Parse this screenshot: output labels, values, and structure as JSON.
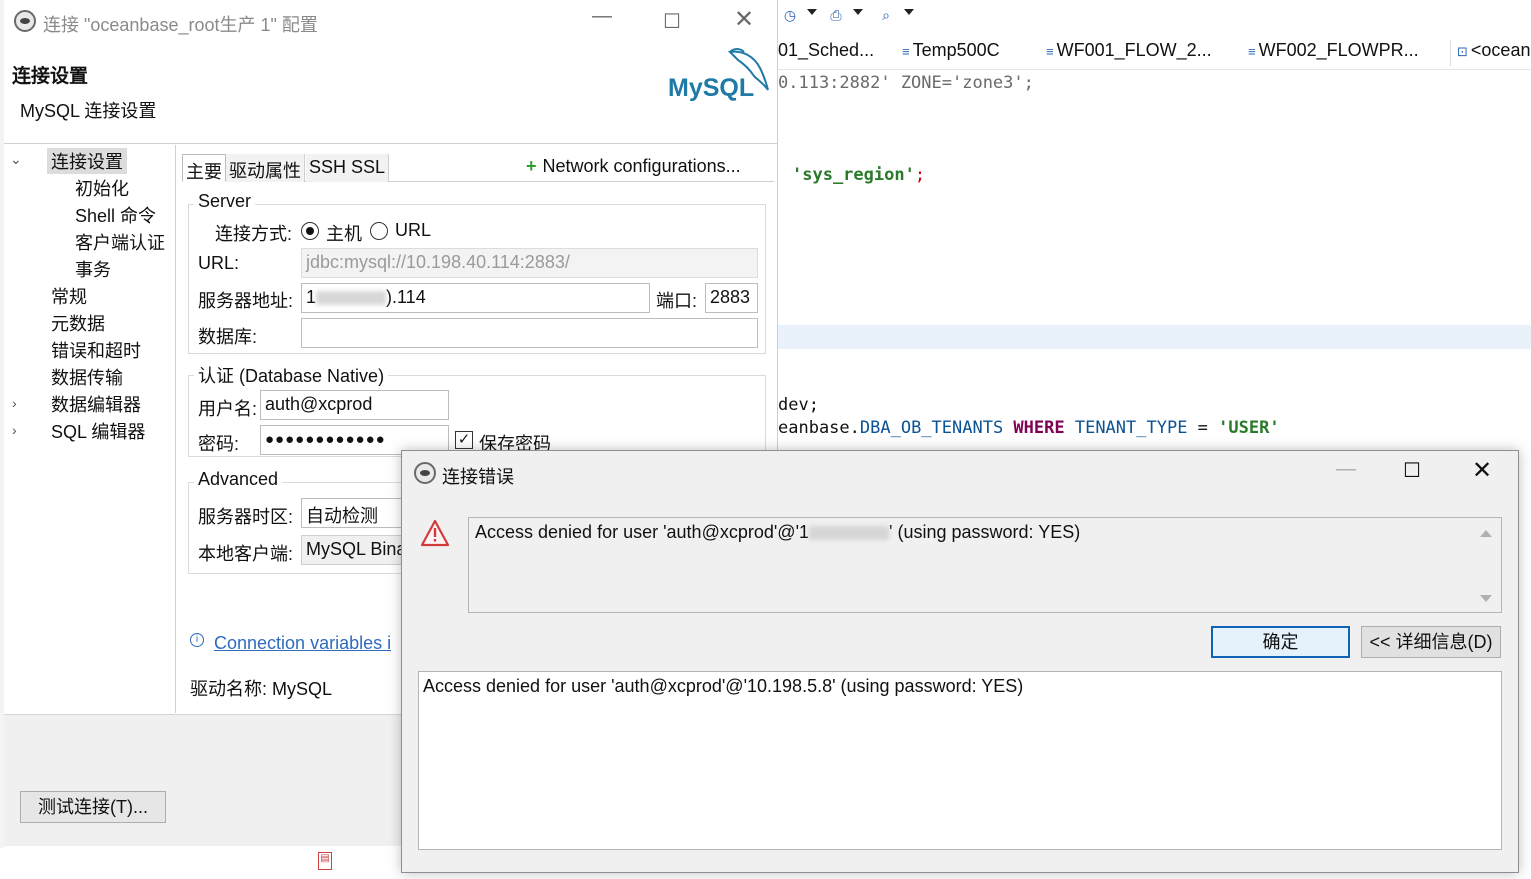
{
  "background": {
    "editor_tabs": [
      {
        "label": "01_Sched..."
      },
      {
        "label": "Temp500C"
      },
      {
        "label": "WF001_FLOW_2..."
      },
      {
        "label": "WF002_FLOWPR..."
      },
      {
        "label": "<ocean"
      }
    ],
    "code": {
      "line1": "0.113:2882' ZONE='zone3';",
      "line2_str": "'sys_region'",
      "line2_end": ";",
      "line3": "dev;",
      "line4_a": "eanbase.",
      "line4_b": "DBA_OB_TENANTS",
      "line4_c": " WHERE ",
      "line4_d": "TENANT_TYPE",
      "line4_e": " = ",
      "line4_f": "'USER'"
    }
  },
  "config_window": {
    "title": "连接 \"oceanbase_root生产 1\" 配置",
    "heading": "连接设置",
    "subheading": "MySQL 连接设置",
    "logo_text": "MySQL",
    "nav": [
      {
        "label": "连接设置"
      },
      {
        "label": "初始化"
      },
      {
        "label": "Shell 命令"
      },
      {
        "label": "客户端认证"
      },
      {
        "label": "事务"
      },
      {
        "label": "常规"
      },
      {
        "label": "元数据"
      },
      {
        "label": "错误和超时"
      },
      {
        "label": "数据传输"
      },
      {
        "label": "数据编辑器"
      },
      {
        "label": "SQL 编辑器"
      }
    ],
    "tabs": [
      {
        "label": "主要"
      },
      {
        "label": "驱动属性"
      },
      {
        "label": "SSH"
      },
      {
        "label": "SSL"
      }
    ],
    "network_config": "Network configurations...",
    "server": {
      "group_title": "Server",
      "connect_mode_label": "连接方式:",
      "option_host": "主机",
      "option_url": "URL",
      "url_label": "URL:",
      "url_value": "jdbc:mysql://10.198.40.114:2883/",
      "host_label": "服务器地址:",
      "host_value_prefix": "1",
      "host_value_suffix": ").114",
      "port_label": "端口:",
      "port_value": "2883",
      "db_label": "数据库:",
      "db_value": ""
    },
    "auth": {
      "group_title": "认证 (Database Native)",
      "user_label": "用户名:",
      "user_value": "auth@xcprod",
      "pwd_label": "密码:",
      "pwd_value": "●●●●●●●●●●●●",
      "save_pwd_label": "保存密码"
    },
    "advanced": {
      "group_title": "Advanced",
      "tz_label": "服务器时区:",
      "tz_value": "自动检测",
      "client_label": "本地客户端:",
      "client_value": "MySQL Bina"
    },
    "conn_vars_link": "Connection variables i",
    "driver_label": "驱动名称:",
    "driver_value": "MySQL",
    "test_button": "测试连接(T)..."
  },
  "error_dialog": {
    "title": "连接错误",
    "message_prefix": "Access denied for user 'auth@xcprod'@'1",
    "message_suffix": "' (using password: YES)",
    "ok_button": "确定",
    "details_button": "<< 详细信息(D)",
    "details_text": "Access denied for user 'auth@xcprod'@'10.198.5.8' (using password: YES)"
  },
  "colors": {
    "keyword": "#7f0055",
    "string": "#2a7a2a",
    "identifier": "#0b5394",
    "accent": "#0f62b6",
    "warning": "#d23c3c"
  }
}
